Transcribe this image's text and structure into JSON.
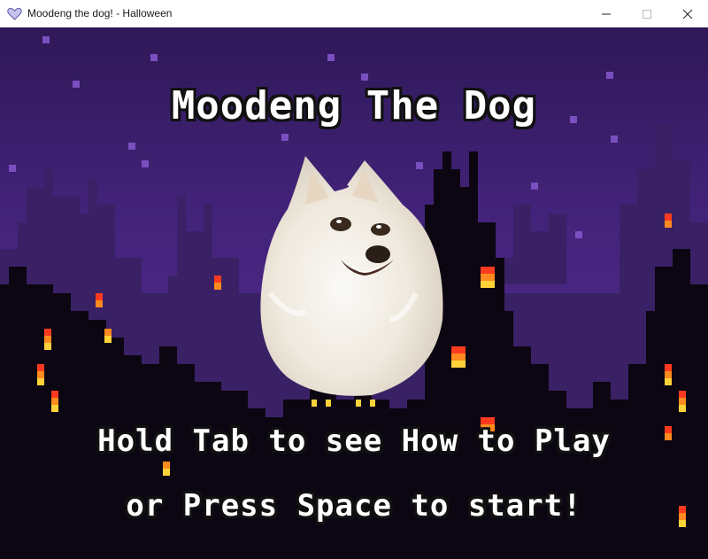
{
  "window": {
    "title": "Moodeng the dog! - Halloween",
    "app_icon": "heart-icon",
    "controls": [
      "minimize-icon",
      "maximize-icon",
      "close-icon"
    ]
  },
  "game": {
    "title": "Moodeng The Dog",
    "prompt_line1": "Hold Tab to see How to Play",
    "prompt_line2": "or Press Space to start!",
    "mascot": "pomeranian-dog-face",
    "theme": "halloween-pixel-city-night"
  },
  "colors": {
    "sky": "#4f2a86",
    "sky_dark": "#2f1858",
    "far_buildings": "#3a2166",
    "near_buildings": "#0c0612",
    "window_fire_top": "#ff3b1f",
    "window_fire_mid": "#ff8a1f",
    "window_fire_low": "#ffd23a",
    "stars": "#7a4fc0",
    "text": "#ffffff",
    "text_outline": "#111111"
  }
}
